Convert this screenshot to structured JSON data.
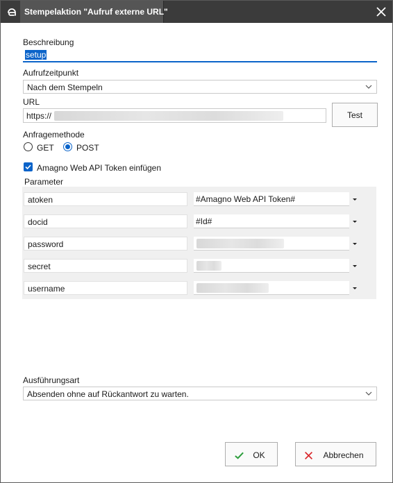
{
  "window": {
    "title": "Stempelaktion \"Aufruf externe URL\""
  },
  "colors": {
    "accent": "#0a63c9",
    "titlebar": "#3b3b3b",
    "ok_green": "#2e9e3e",
    "cancel_red": "#d9262b"
  },
  "icons": {
    "app": "app-logo-icon",
    "close": "close-icon",
    "ok": "checkmark-icon",
    "cancel": "x-icon",
    "dropdown": "chevron-down-icon"
  },
  "form": {
    "beschreibung": {
      "label": "Beschreibung",
      "value": "setup"
    },
    "aufrufzeitpunkt": {
      "label": "Aufrufzeitpunkt",
      "selected": "Nach dem Stempeln"
    },
    "url": {
      "label": "URL",
      "value": "https://",
      "test_label": "Test"
    },
    "anfragemethode": {
      "label": "Anfragemethode",
      "options": [
        "GET",
        "POST"
      ],
      "selected": "POST"
    },
    "token": {
      "label": "Amagno Web API Token einfügen",
      "checked": true
    },
    "parameter": {
      "label": "Parameter",
      "rows": [
        {
          "name": "atoken",
          "value": "#Amagno Web API Token#"
        },
        {
          "name": "docid",
          "value": "#Id#"
        },
        {
          "name": "password",
          "value": ""
        },
        {
          "name": "secret",
          "value": ""
        },
        {
          "name": "username",
          "value": ""
        }
      ]
    },
    "ausfuehrungsart": {
      "label": "Ausführungsart",
      "selected": "Absenden ohne auf Rückantwort zu warten."
    }
  },
  "buttons": {
    "ok": "OK",
    "cancel": "Abbrechen"
  }
}
